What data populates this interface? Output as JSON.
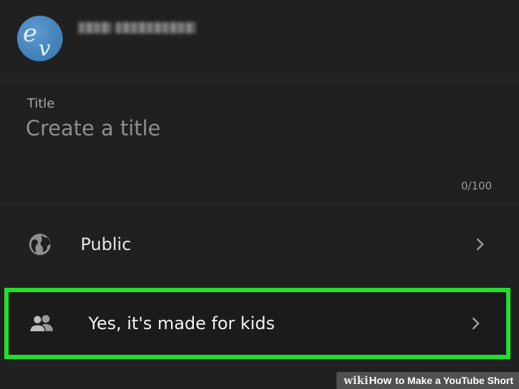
{
  "channel": {
    "avatar_icon": "channel-avatar-ev-logo",
    "name": ""
  },
  "title_field": {
    "label": "Title",
    "placeholder": "Create a title",
    "value": "",
    "counter": "0/100"
  },
  "settings": {
    "visibility": {
      "icon": "globe-icon",
      "label": "Public"
    },
    "audience": {
      "icon": "people-icon",
      "label": "Yes, it's made for kids",
      "highlight_color": "#22e02a"
    }
  },
  "watermark": {
    "wiki": "wiki",
    "how": "How",
    "rest": "to Make a YouTube Short"
  }
}
